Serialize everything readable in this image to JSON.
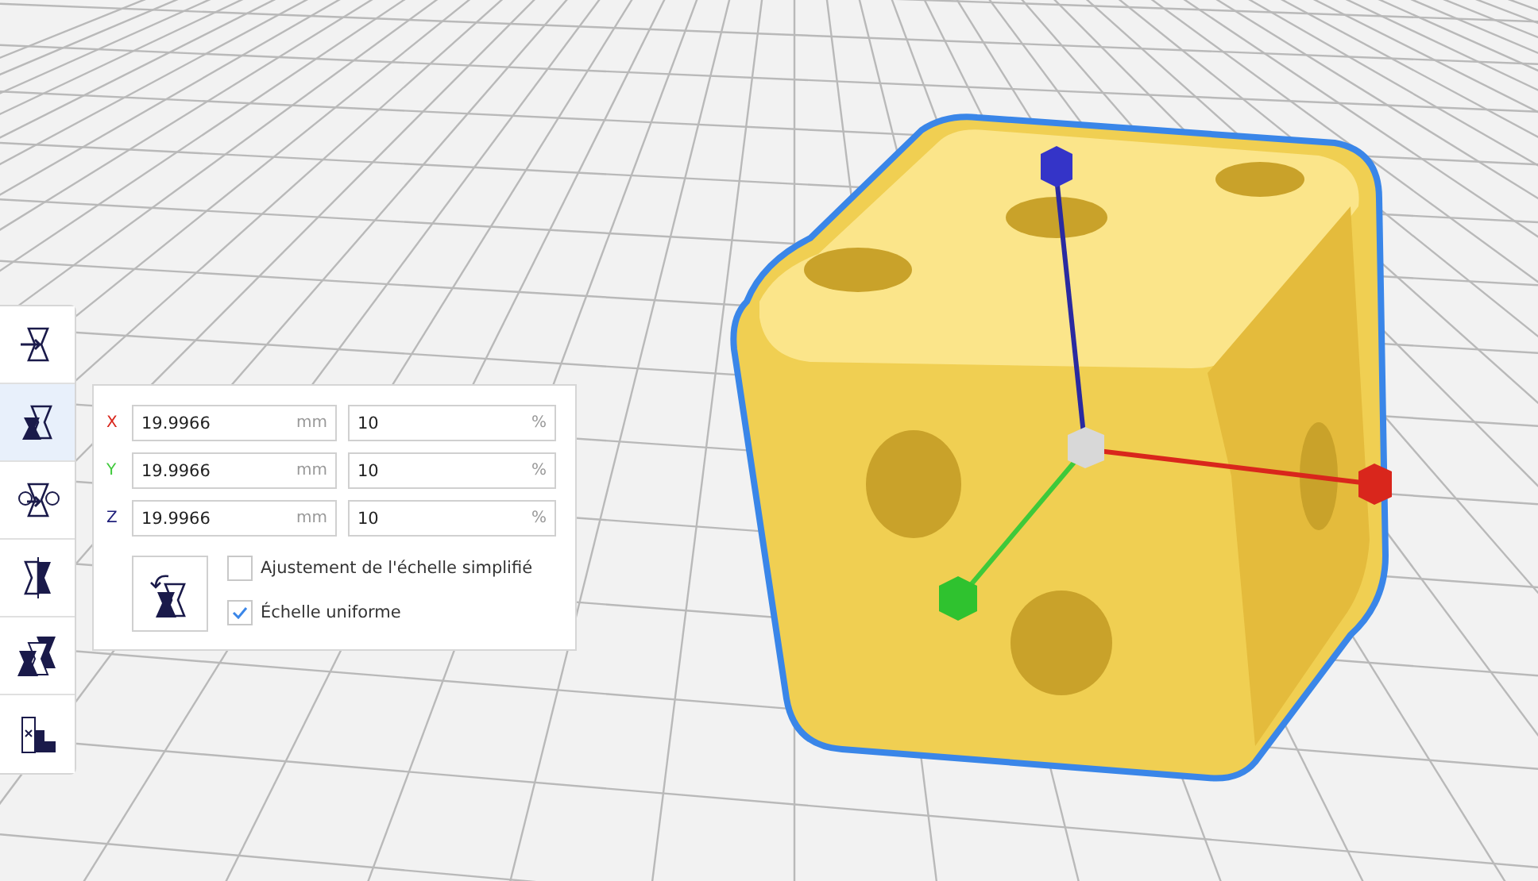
{
  "tools": [
    {
      "selected": false
    },
    {
      "selected": true
    },
    {
      "selected": false
    },
    {
      "selected": false
    },
    {
      "selected": false
    },
    {
      "selected": false
    }
  ],
  "scale_panel": {
    "rows": [
      {
        "axis": "X",
        "color": "#d9261c",
        "mm_value": "19.9966",
        "mm_unit": "mm",
        "percent_value": "10",
        "percent_unit": "%"
      },
      {
        "axis": "Y",
        "color": "#3ec93a",
        "mm_value": "19.9966",
        "mm_unit": "mm",
        "percent_value": "10",
        "percent_unit": "%"
      },
      {
        "axis": "Z",
        "color": "#1e1e7a",
        "mm_value": "19.9966",
        "mm_unit": "mm",
        "percent_value": "10",
        "percent_unit": "%"
      }
    ],
    "options": [
      {
        "label": "Ajustement de l'échelle simplifié",
        "checked": false
      },
      {
        "label": "Échelle uniforme",
        "checked": true
      }
    ]
  }
}
